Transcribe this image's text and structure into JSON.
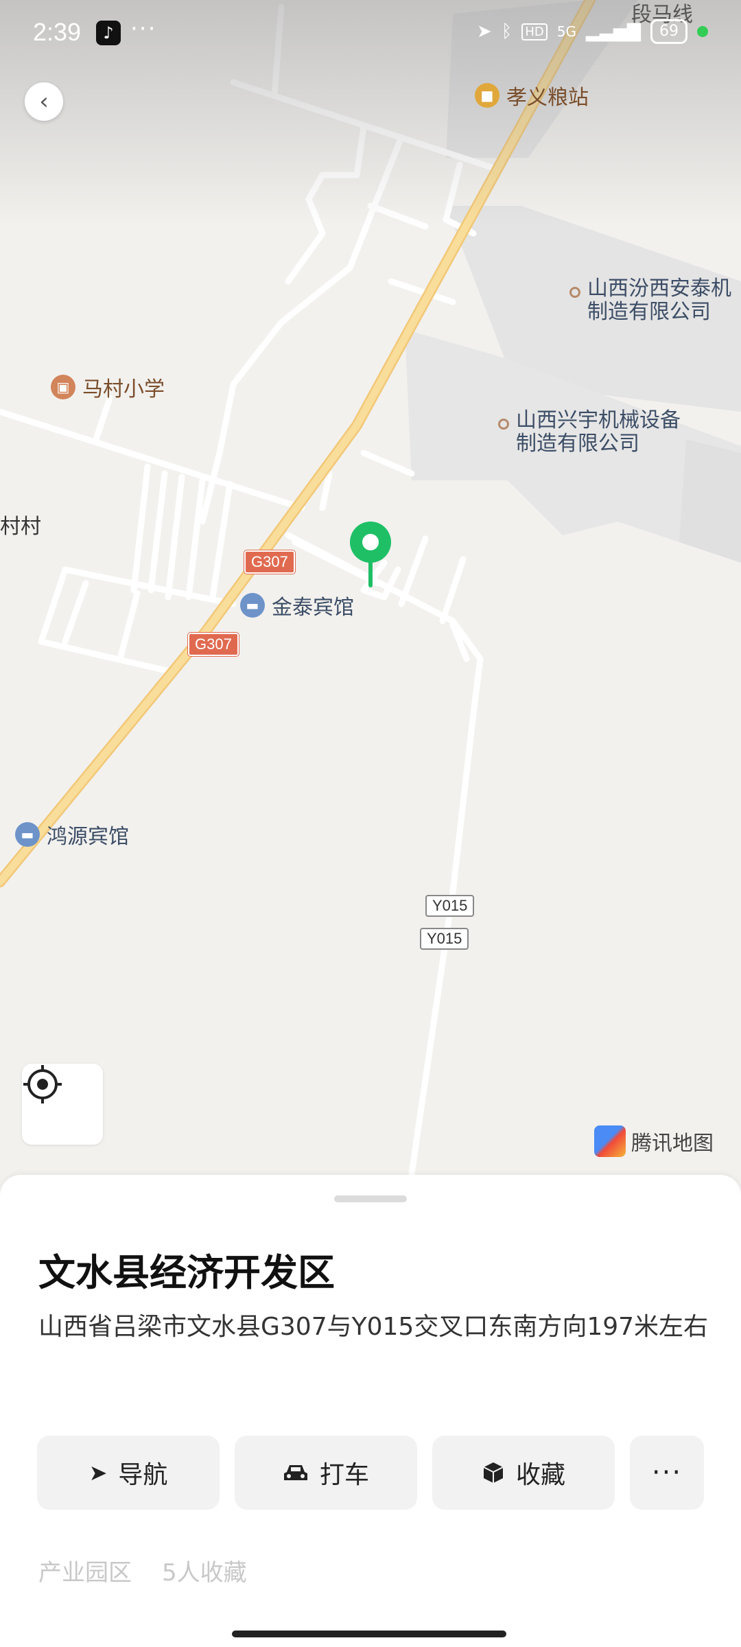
{
  "status_bar": {
    "time": "2:39",
    "network": "5G",
    "hd": "HD",
    "battery": "69"
  },
  "map": {
    "road_label_top": "段马线",
    "pois": {
      "grain_station": "孝义粮站",
      "school": "马村小学",
      "company_1": "山西汾西安泰机\n制造有限公司",
      "company_2": "山西兴宇机械设备\n制造有限公司",
      "hotel_jintai": "金泰宾馆",
      "hotel_hongyuan": "鸿源宾馆",
      "village": "村村"
    },
    "shields": {
      "g307_a": "G307",
      "g307_b": "G307",
      "y015_a": "Y015",
      "y015_b": "Y015"
    },
    "brand": "腾讯地图",
    "colors": {
      "pin": "#1fbf66",
      "highway": "#f7d98c",
      "building": "#e4e4e4"
    }
  },
  "sheet": {
    "title": "文水县经济开发区",
    "address": "山西省吕梁市文水县G307与Y015交叉口东南方向197米左右",
    "actions": {
      "navigate": "导航",
      "taxi": "打车",
      "favorite": "收藏",
      "more": "···"
    },
    "meta": {
      "category": "产业园区",
      "favorites": "5人收藏"
    }
  }
}
